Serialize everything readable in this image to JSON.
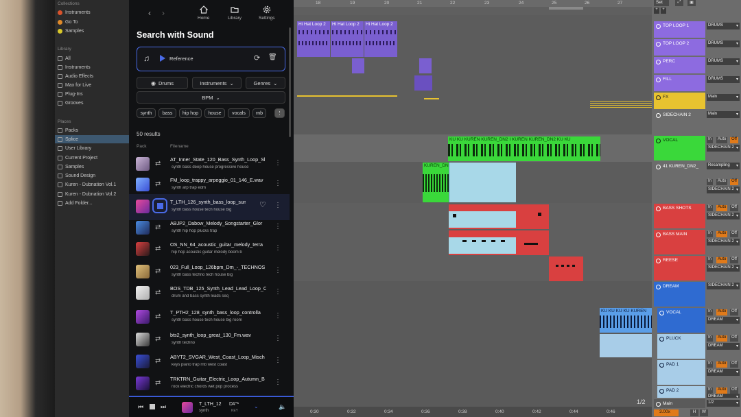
{
  "browser": {
    "collections_label": "Collections",
    "collections": [
      "Instruments",
      "Go To",
      "Samples"
    ],
    "library_label": "Library",
    "library": [
      "All",
      "Instruments",
      "Audio Effects",
      "Max for Live",
      "Plug-Ins",
      "Grooves"
    ],
    "places_label": "Places",
    "places": [
      "Packs",
      "Splice",
      "User Library",
      "Current Project",
      "Samples",
      "Sound Design",
      "Kuren - Dubnation Vol.1",
      "Kuren - Dubnation Vol.2",
      "Add Folder..."
    ]
  },
  "splice": {
    "nav": {
      "home": "Home",
      "library": "Library",
      "settings": "Settings"
    },
    "title": "Search with Sound",
    "reference_label": "Reference",
    "filters": {
      "drums": "Drums",
      "instruments": "Instruments",
      "genres": "Genres",
      "bpm": "BPM"
    },
    "chips": [
      "synth",
      "bass",
      "hip hop",
      "house",
      "vocals",
      "rnb"
    ],
    "results_count": "50 results",
    "col_pack": "Pack",
    "col_filename": "Filename",
    "results": [
      {
        "name": "AT_Inner_State_120_Bass_Synth_Loop_Sl",
        "tags": "synth   bass   deep house   progressive house"
      },
      {
        "name": "FM_loop_trappy_arpeggio_01_146_E.wav",
        "tags": "synth   arp   trap edm"
      },
      {
        "name": "T_LTH_126_synth_bass_loop_sumne",
        "tags": "synth   bass   house   tech house   big"
      },
      {
        "name": "ABJP2_Dabow_Melody_Songstarter_Glor",
        "tags": "synth   hip hop   plucks   trap"
      },
      {
        "name": "OS_NN_64_acoustic_guitar_melody_terra",
        "tags": "hip hop   acoustic   guitar   melody   boom b"
      },
      {
        "name": "023_Full_Loop_126bpm_Dm_-_TECHNOS",
        "tags": "synth   bass   techno   tech house   big"
      },
      {
        "name": "BOS_TDB_125_Synth_Lead_Lead_Loop_C",
        "tags": "drum and bass   synth   leads   seq"
      },
      {
        "name": "T_PTH2_128_synth_bass_loop_controlla",
        "tags": "synth   bass   house   tech house   big room"
      },
      {
        "name": "bts2_synth_loop_great_130_Fm.wav",
        "tags": "synth   techno"
      },
      {
        "name": "ABYT2_SVGAR_West_Coast_Loop_Misch",
        "tags": "keys   piano   trap   rnb   west coast"
      },
      {
        "name": "TRKTRN_Guitar_Electric_Loop_Autumn_B",
        "tags": "rock   electric   chords   wet   pop   process"
      }
    ],
    "player": {
      "name": "T_LTH_12",
      "tags": "synth",
      "key": "D#°¹",
      "key2": "KEY"
    }
  },
  "arrangement": {
    "bars_top": [
      "18",
      "19",
      "20",
      "21",
      "22",
      "23",
      "24",
      "25",
      "26",
      "27"
    ],
    "times_bottom": [
      "0:30",
      "0:32",
      "0:34",
      "0:36",
      "0:38",
      "0:40",
      "0:42",
      "0:44",
      "0:46"
    ],
    "page": "1/2",
    "zoom": "3.00x",
    "clips": {
      "hh1": "Hi Hat Loop 2",
      "hh2": "Hi Hat Loop 2",
      "hh3": "Hi Hat Loop 2",
      "vocal": "KU KU KUREN   KUREN_DN2   I KUREN   KUREN_DN2   KU KU",
      "kuren": "KUREN_DN",
      "vocal2": "KU KU KU KU KUREN"
    }
  },
  "set": {
    "label": "Set"
  },
  "tracks": [
    {
      "name": "TOP LOOP 1",
      "route": "DRUMS",
      "color": "#8d6be0"
    },
    {
      "name": "TOP LOOP 2",
      "route": "DRUMS",
      "color": "#8d6be0"
    },
    {
      "name": "PERC",
      "route": "DRUMS",
      "color": "#8d6be0"
    },
    {
      "name": "FILL",
      "route": "DRUMS",
      "color": "#8d6be0"
    },
    {
      "name": "FX",
      "route": "Main",
      "color": "#e8c330"
    },
    {
      "name": "SIDECHAIN 2",
      "route": "Main",
      "color": "#6c6c6c"
    },
    {
      "name": "VOCAL",
      "route": "SIDECHAIN 2",
      "color": "#3ad83a"
    },
    {
      "name": "41 KUREN_DN2_",
      "route": "Resampling",
      "color": "#6c6c6c"
    },
    {
      "name": "BASS SHOTS",
      "route": "SIDECHAIN 2",
      "color": "#d94040"
    },
    {
      "name": "BASS MAIN",
      "route": "SIDECHAIN 2",
      "color": "#d94040"
    },
    {
      "name": "REESE",
      "route": "SIDECHAIN 2",
      "color": "#d94040"
    },
    {
      "name": "DREAM",
      "route": "SIDECHAIN 2",
      "color": "#2f6bd1"
    },
    {
      "name": "VOCAL",
      "route": "DREAM",
      "color": "#5a9ee8"
    },
    {
      "name": "PLUCK",
      "route": "DREAM",
      "color": "#a8cde8"
    },
    {
      "name": "PAD 1",
      "route": "DREAM",
      "color": "#a8cde8"
    },
    {
      "name": "PAD 2",
      "route": "DREAM",
      "color": "#a8cde8"
    },
    {
      "name": "Main",
      "route": "1/2",
      "color": "#6c6c6c"
    }
  ],
  "io": {
    "in": "In",
    "auto": "Auto",
    "off": "Off"
  }
}
